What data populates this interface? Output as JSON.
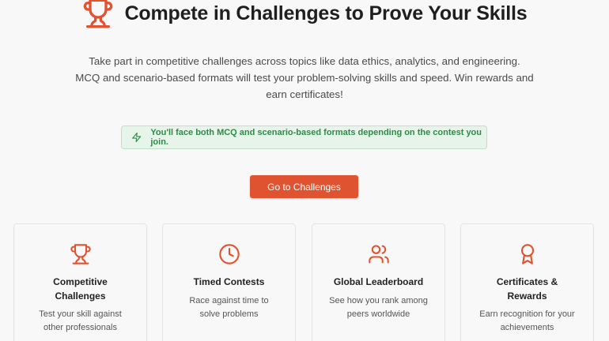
{
  "hero": {
    "title": "Compete in Challenges to Prove Your Skills",
    "icon": "trophy-icon",
    "description": "Take part in competitive challenges across topics like data ethics, analytics, and engineering. MCQ and scenario-based formats will test your problem-solving skills and speed. Win rewards and earn certificates!"
  },
  "notice": {
    "icon": "lightning-icon",
    "text": "You'll face both MCQ and scenario-based formats depending on the contest you join."
  },
  "cta": {
    "label": "Go to Challenges"
  },
  "features": [
    {
      "icon": "trophy-icon",
      "title": "Competitive Challenges",
      "description": "Test your skill against other professionals"
    },
    {
      "icon": "clock-icon",
      "title": "Timed Contests",
      "description": "Race against time to solve problems"
    },
    {
      "icon": "users-icon",
      "title": "Global Leaderboard",
      "description": "See how you rank among peers worldwide"
    },
    {
      "icon": "award-icon",
      "title": "Certificates & Rewards",
      "description": "Earn recognition for your achievements"
    }
  ],
  "colors": {
    "accent": "#e05330",
    "notice_bg": "#e7f4ea",
    "notice_text": "#2f8a49",
    "background": "#f8f8f8"
  }
}
